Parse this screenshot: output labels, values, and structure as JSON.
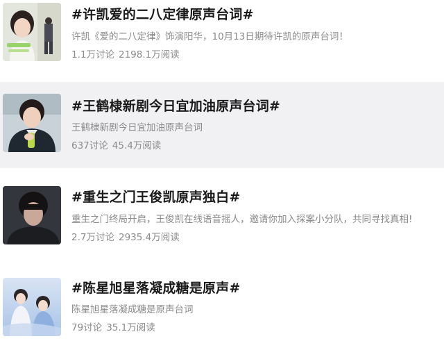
{
  "topics": [
    {
      "title": "#许凯爱的二八定律原声台词#",
      "description": "许凯《爱的二八定律》饰演阳华，10月13日期待许凯的原声台词！",
      "discussions": "1.1万讨论",
      "reads": "2198.1万阅读",
      "thumbnail": "portrait-photo-icon"
    },
    {
      "title": "#王鹤棣新剧今日宜加油原声台词#",
      "description": "王鹤棣新剧今日宜加油原声台词",
      "discussions": "637讨论",
      "reads": "45.4万阅读",
      "thumbnail": "portrait-photo-icon"
    },
    {
      "title": "#重生之门王俊凯原声独白#",
      "description": "重生之门终局开启，王俊凯在线语音摇人，邀请你加入探案小分队，共同寻找真相!",
      "discussions": "2.7万讨论",
      "reads": "2935.4万阅读",
      "thumbnail": "portrait-photo-icon"
    },
    {
      "title": "#陈星旭星落凝成糖是原声#",
      "description": "陈星旭星落凝成糖是原声台词",
      "discussions": "79讨论",
      "reads": "35.1万阅读",
      "thumbnail": "poster-photo-icon"
    }
  ]
}
